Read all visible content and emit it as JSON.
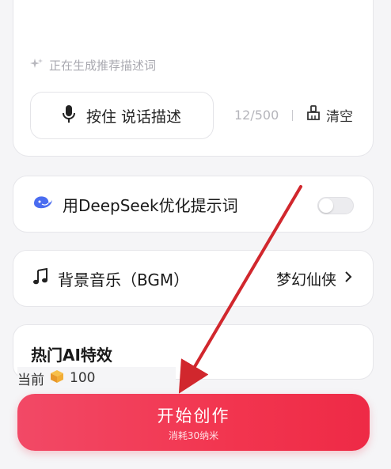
{
  "prompt": {
    "hint_text": "正在生成推荐描述词",
    "voice_button_label": "按住 说话描述",
    "counter": "12/500",
    "clear_label": "清空"
  },
  "deepseek": {
    "label": "用DeepSeek优化提示词",
    "toggle_on": false
  },
  "bgm": {
    "label": "背景音乐（BGM）",
    "value": "梦幻仙侠"
  },
  "effects": {
    "title": "热门AI特效"
  },
  "balance": {
    "label": "当前",
    "amount": "100"
  },
  "create": {
    "label": "开始创作",
    "cost": "消耗30纳米"
  },
  "colors": {
    "accent": "#f2354f",
    "annotation_arrow": "#d1272d"
  },
  "icons": [
    "sparkle-icon",
    "microphone-icon",
    "broom-icon",
    "deepseek-whale-icon",
    "music-note-icon",
    "chevron-right-icon",
    "coin-cube-icon"
  ]
}
